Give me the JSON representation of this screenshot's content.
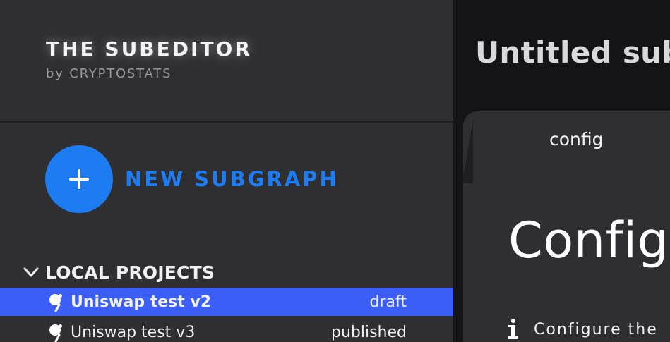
{
  "brand": {
    "title": "THE SUBEDITOR",
    "subtitle": "by CRYPTOSTATS"
  },
  "sidebar": {
    "new_button_label": "NEW SUBGRAPH",
    "section_label": "LOCAL PROJECTS",
    "projects": [
      {
        "name": "Uniswap test v2",
        "status": "draft",
        "selected": true
      },
      {
        "name": "Uniswap test v3",
        "status": "published",
        "selected": false
      }
    ]
  },
  "main": {
    "title": "Untitled subg",
    "tab_label": "config",
    "heading": "Config",
    "info_text": "Configure the"
  },
  "colors": {
    "sidebar_bg": "#2f2f31",
    "main_bg": "#141416",
    "accent_blue": "#1d7cf2",
    "selected_row": "#3b5ef7"
  },
  "icons": {
    "plus": "plus-icon",
    "chevron": "chevron-down-icon",
    "project": "subgraph-icon",
    "info": "info-icon"
  }
}
